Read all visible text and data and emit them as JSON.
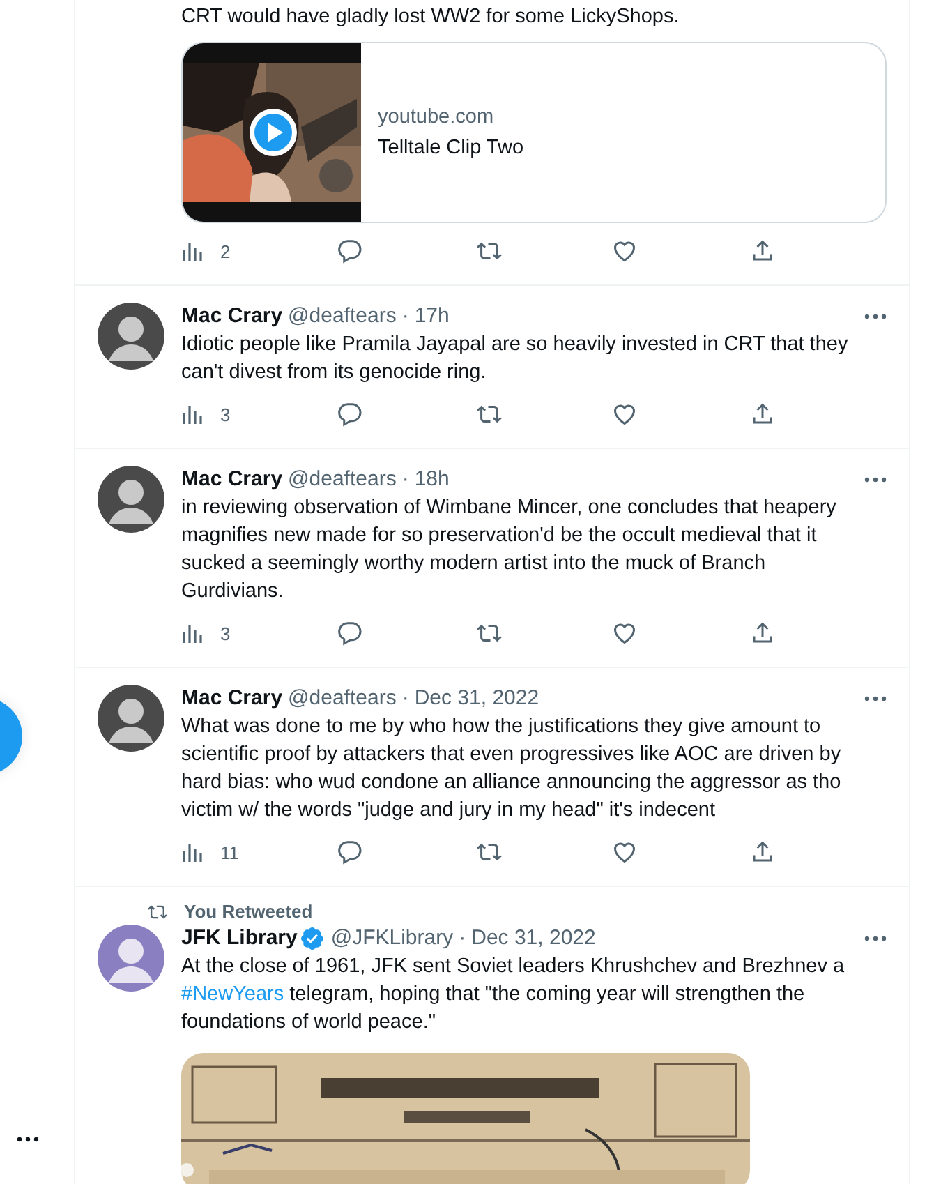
{
  "tweets": [
    {
      "text_parts": [
        {
          "kind": "plain",
          "text": "CRT would have gladly lost WW2 for some LickyShops."
        }
      ],
      "link_card": {
        "domain": "youtube.com",
        "title": "Telltale Clip Two"
      },
      "views": "2"
    },
    {
      "author": "Mac Crary",
      "verified": false,
      "handle": "@deaftears",
      "dot": "·",
      "time": "17h",
      "text_parts": [
        {
          "kind": "plain",
          "text": "Idiotic people like Pramila Jayapal are so heavily invested in CRT that they can't divest from its genocide ring."
        }
      ],
      "views": "3"
    },
    {
      "author": "Mac Crary",
      "verified": false,
      "handle": "@deaftears",
      "dot": "·",
      "time": "18h",
      "text_parts": [
        {
          "kind": "plain",
          "text": "in reviewing observation of Wimbane Mincer, one concludes that heapery magnifies new made for so preservation'd be the occult medieval that it sucked a seemingly worthy modern artist into the muck of Branch Gurdivians."
        }
      ],
      "views": "3"
    },
    {
      "author": "Mac Crary",
      "verified": false,
      "handle": "@deaftears",
      "dot": "·",
      "time": "Dec 31, 2022",
      "text_parts": [
        {
          "kind": "plain",
          "text": "What was done to me by who how the justifications they give amount to scientific proof by attackers that even progressives like AOC are driven by hard bias:  who wud condone an alliance announcing the aggressor as tho victim w/ the words \"judge and jury in my head\" it's indecent"
        }
      ],
      "views": "11"
    },
    {
      "retweeted_by": "You Retweeted",
      "author": "JFK Library",
      "verified": true,
      "handle": "@JFKLibrary",
      "dot": "·",
      "time": "Dec 31, 2022",
      "text_parts": [
        {
          "kind": "plain",
          "text": "At the close of 1961, JFK sent Soviet leaders Khrushchev and Brezhnev a "
        },
        {
          "kind": "hashtag",
          "text": "#NewYears"
        },
        {
          "kind": "plain",
          "text": " telegram, hoping that \"the coming year will strengthen the foundations of world peace.\""
        }
      ]
    }
  ]
}
